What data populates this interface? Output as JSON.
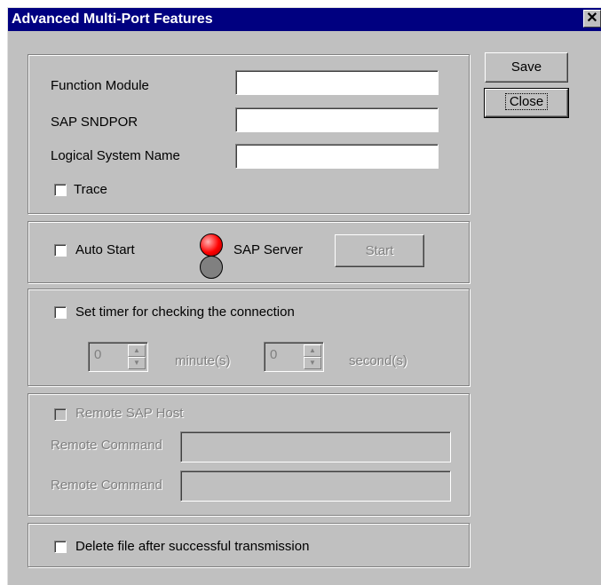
{
  "window": {
    "title": "Advanced Multi-Port Features",
    "close_glyph": "✕"
  },
  "buttons": {
    "save": "Save",
    "close": "Close"
  },
  "params": {
    "function_module_label": "Function Module",
    "function_module_value": "",
    "sap_sndpor_label": "SAP SNDPOR",
    "sap_sndpor_value": "",
    "logical_system_label": "Logical System Name",
    "logical_system_value": "",
    "trace_label": "Trace"
  },
  "server": {
    "auto_start_label": "Auto Start",
    "sap_server_label": "SAP Server",
    "start_button": "Start",
    "led_top_color": "#ff0000",
    "led_bottom_color": "#808080"
  },
  "timer": {
    "label": "Set timer for checking the connection",
    "minutes_value": "0",
    "minutes_label": "minute(s)",
    "seconds_value": "0",
    "seconds_label": "second(s)"
  },
  "remote": {
    "host_label": "Remote SAP Host",
    "command1_label": "Remote Command",
    "command1_value": "",
    "command2_label": "Remote Command",
    "command2_value": ""
  },
  "delete": {
    "label": "Delete file after successful transmission"
  }
}
